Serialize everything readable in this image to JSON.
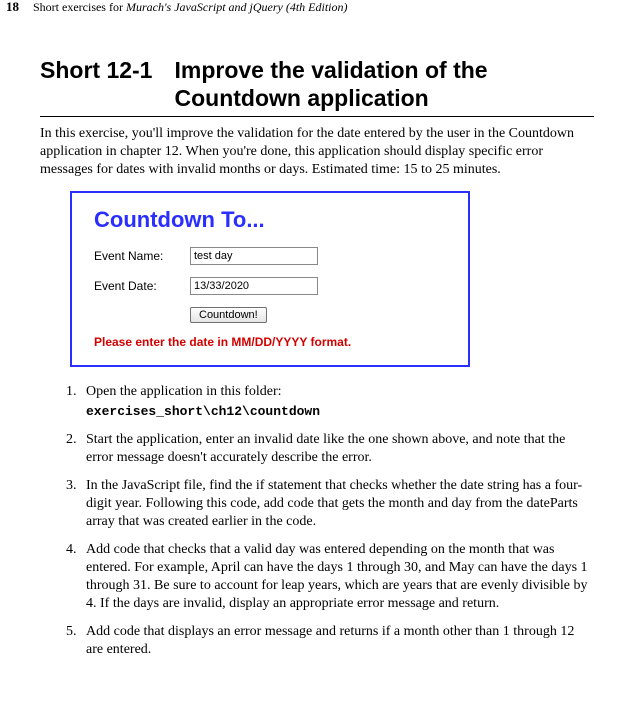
{
  "running_head": {
    "page_number": "18",
    "prefix": "Short exercises for ",
    "book_title": "Murach's JavaScript and jQuery (4th Edition)"
  },
  "exercise": {
    "short_label": "Short 12-1",
    "title": "Improve the validation of the Countdown application",
    "intro": "In this exercise, you'll improve the validation for the date entered by the user in the Countdown application in chapter 12. When you're done, this application should display specific error messages for dates with invalid months or days. Estimated time: 15 to 25 minutes."
  },
  "screenshot": {
    "app_title": "Countdown To...",
    "event_name_label": "Event Name:",
    "event_name_value": "test day",
    "event_date_label": "Event Date:",
    "event_date_value": "13/33/2020",
    "button_label": "Countdown!",
    "error_message": "Please enter the date in MM/DD/YYYY format."
  },
  "steps": {
    "s1_text": "Open the application in this folder:",
    "s1_path": "exercises_short\\ch12\\countdown",
    "s2_text": "Start the application, enter an invalid date like the one shown above, and note that the error message doesn't accurately describe the error.",
    "s3_text": "In the JavaScript file, find the if statement that checks whether the date string has a four-digit year. Following this code, add code that gets the month and day from the dateParts array that was created earlier in the code.",
    "s4_text": "Add code that checks that a valid day was entered depending on the month that was entered. For example, April can have the days 1 through 30, and May can have the days 1 through 31. Be sure to account for leap years, which are years that are evenly divisible by 4. If the days are invalid, display an appropriate error message and return.",
    "s5_text": "Add code that displays an error message and returns if a month other than 1 through 12 are entered."
  }
}
